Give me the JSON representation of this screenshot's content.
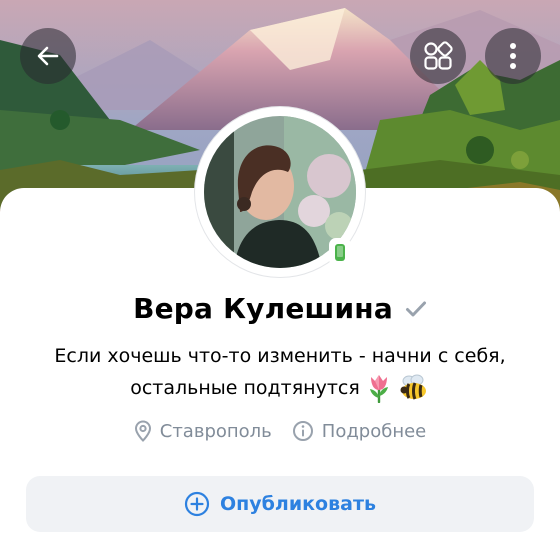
{
  "profile": {
    "name": "Вера Кулешина",
    "status_line1": "Если хочешь что-то изменить -  начни с себя,",
    "status_line2": "остальные подтянутся",
    "status_emojis": [
      "tulip-emoji",
      "bee-emoji"
    ],
    "city": "Ставрополь",
    "details_link": "Подробнее",
    "online_indicator": "mobile"
  },
  "actions": {
    "publish_label": "Опубликовать"
  },
  "icons": {
    "back": "arrow-left-icon",
    "apps": "apps-grid-icon",
    "more": "more-vertical-icon",
    "verified": "check-icon",
    "location": "location-pin-icon",
    "info": "info-circle-icon",
    "add": "plus-circle-icon"
  },
  "colors": {
    "accent": "#2d81e0",
    "secondary_text": "#818c99",
    "online": "#4bb34b",
    "button_bg": "#f0f2f5"
  }
}
